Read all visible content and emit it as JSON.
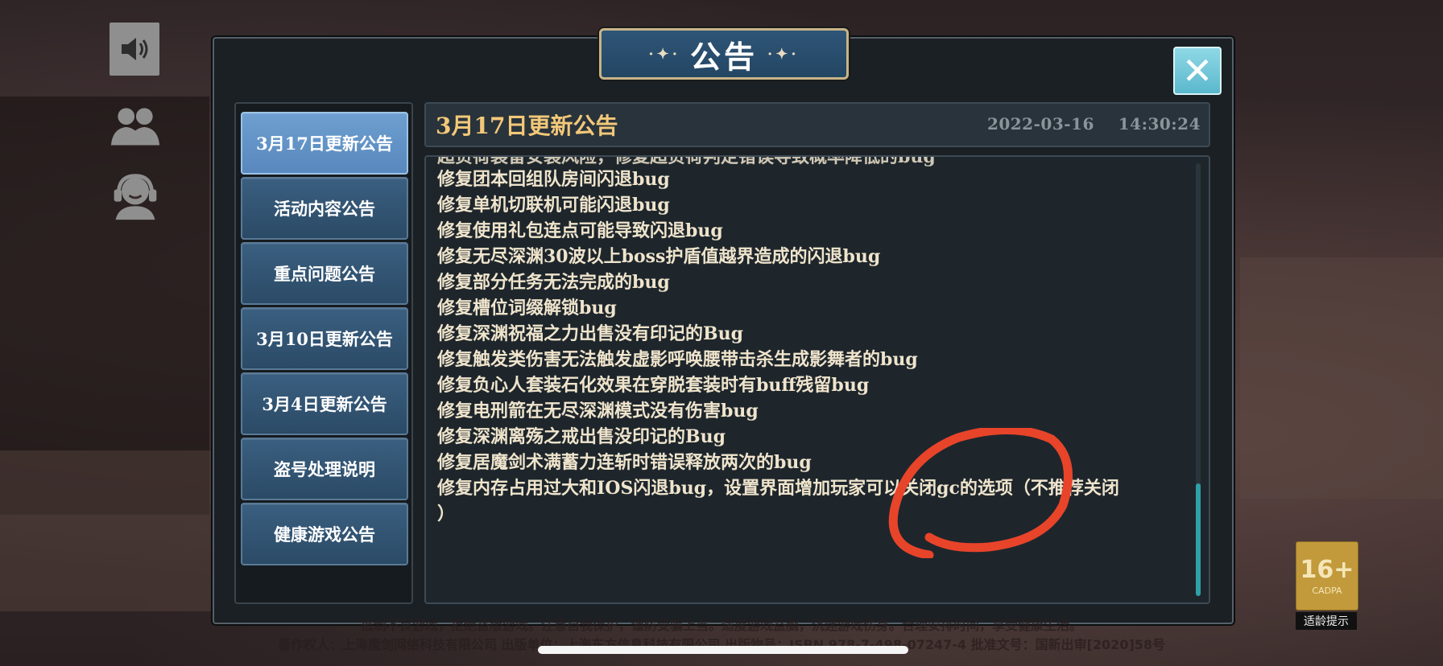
{
  "dialog": {
    "title": "公告",
    "title_deco_left": "·✦·",
    "title_deco_right": "·✦·",
    "close_label": "✕"
  },
  "hud": {
    "icons": [
      "speaker-icon",
      "friends-icon",
      "customer-service-icon"
    ]
  },
  "tabs": [
    {
      "label": "3月17日更新公告",
      "active": true
    },
    {
      "label": "活动内容公告",
      "active": false
    },
    {
      "label": "重点问题公告",
      "active": false
    },
    {
      "label": "3月10日更新公告",
      "active": false
    },
    {
      "label": "3月4日更新公告",
      "active": false
    },
    {
      "label": "盗号处理说明",
      "active": false
    },
    {
      "label": "健康游戏公告",
      "active": false
    }
  ],
  "notice": {
    "title": "3月17日更新公告",
    "date": "2022-03-16",
    "time": "14:30:24",
    "lines": [
      "超负荷装备安装风险，修复超负荷判定错误导致概率降低的bug",
      "修复团本回组队房间闪退bug",
      "修复单机切联机可能闪退bug",
      "修复使用礼包连点可能导致闪退bug",
      "修复无尽深渊30波以上boss护盾值越界造成的闪退bug",
      "修复部分任务无法完成的bug",
      "修复槽位词缀解锁bug",
      "修复深渊祝福之力出售没有印记的Bug",
      "修复触发类伤害无法触发虚影呼唤腰带击杀生成影舞者的bug",
      "修复负心人套装石化效果在穿脱套装时有buff残留bug",
      "修复电刑箭在无尽深渊模式没有伤害bug",
      "修复深渊离殇之戒出售没印记的Bug",
      "修复居魔剑术满蓄力连斩时错误释放两次的bug",
      "修复内存占用过大和IOS闪退bug，设置界面增加玩家可以关闭gc的选项（不推荐关闭",
      "）"
    ]
  },
  "footer": {
    "line1": "抵制不良游戏，拒绝盗版游戏。注意自我保护，谨防受骗上当。适度游戏益脑，沉迷游戏伤身。合理安排时间，享受健康生活。",
    "line2": "著作权人：上海魔剑网络科技有限公司   出版单位：上海东方信息科技有限公司   出版物号：ISBN 978-7-498-07247-4   批准文号：国新出审[2020]58号"
  },
  "age_badge": {
    "rating": "16+",
    "org": "CADPA",
    "label": "适龄提示"
  }
}
